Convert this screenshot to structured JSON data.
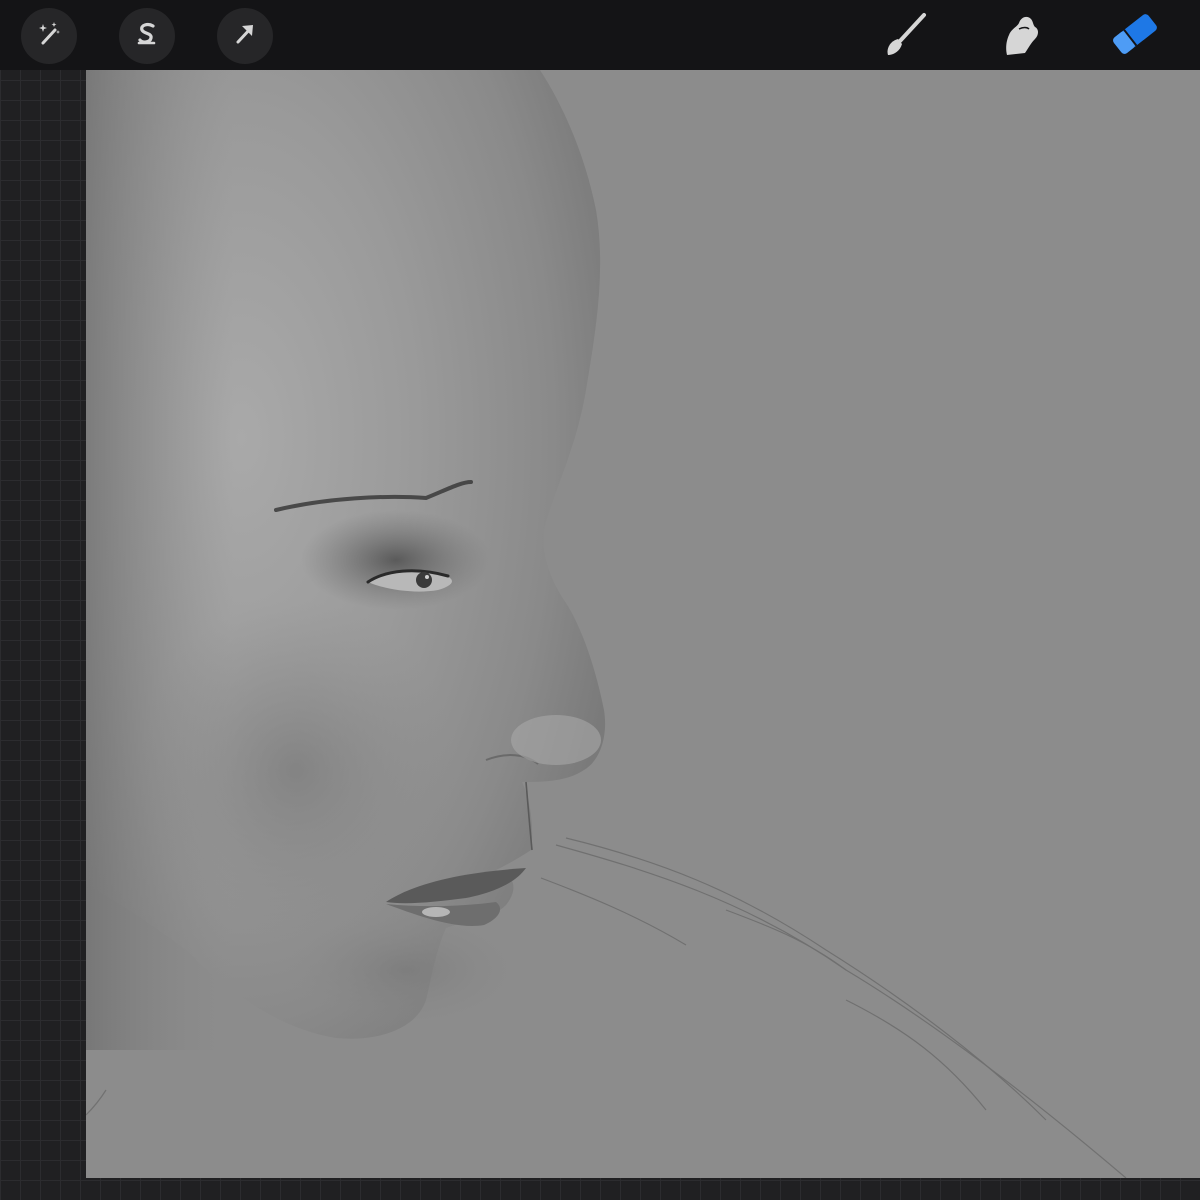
{
  "app": {
    "toolbar": {
      "left_tools": [
        {
          "name": "adjustments",
          "icon": "magic-wand-icon"
        },
        {
          "name": "selection",
          "icon": "selection-s-icon"
        },
        {
          "name": "transform",
          "icon": "arrow-cursor-icon"
        }
      ],
      "right_tools": [
        {
          "name": "brush",
          "icon": "brush-icon",
          "active": false
        },
        {
          "name": "smudge",
          "icon": "smudge-finger-icon",
          "active": false
        },
        {
          "name": "eraser",
          "icon": "eraser-icon",
          "active": true
        }
      ]
    },
    "colors": {
      "toolbar_bg": "#141416",
      "active_tool": "#1e78e6",
      "inactive_tool": "#d6d6d6",
      "canvas_bg": "#8c8c8c"
    },
    "canvas": {
      "artwork": "grayscale-portrait-profile-sketch"
    }
  }
}
